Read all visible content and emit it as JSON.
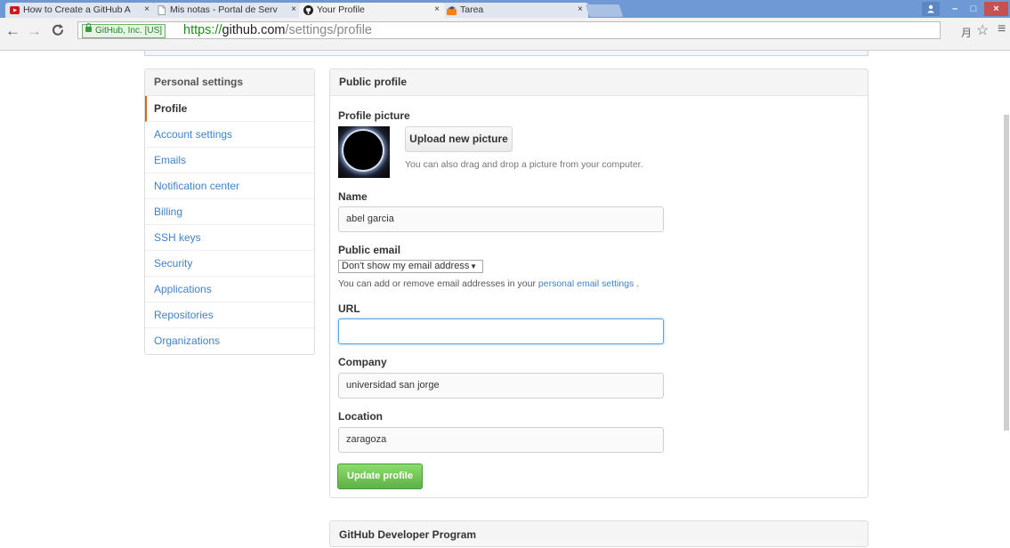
{
  "browser": {
    "tabs": [
      {
        "title": "How to Create a GitHub A",
        "icon": "youtube-icon",
        "active": false
      },
      {
        "title": "Mis notas - Portal de Serv",
        "icon": "page-icon",
        "active": false
      },
      {
        "title": "Your Profile",
        "icon": "github-icon",
        "active": true
      },
      {
        "title": "Tarea",
        "icon": "moodle-icon",
        "active": false
      }
    ],
    "tab_close": "×",
    "secure_label": "GitHub, Inc. [US]",
    "url_scheme": "https://",
    "url_host": "github.com",
    "url_path": "/settings/profile",
    "window_controls": {
      "minimize": "–",
      "maximize": "□",
      "close": "×"
    }
  },
  "sidebar": {
    "heading": "Personal settings",
    "items": [
      {
        "label": "Profile",
        "selected": true
      },
      {
        "label": "Account settings"
      },
      {
        "label": "Emails"
      },
      {
        "label": "Notification center"
      },
      {
        "label": "Billing"
      },
      {
        "label": "SSH keys"
      },
      {
        "label": "Security"
      },
      {
        "label": "Applications"
      },
      {
        "label": "Repositories"
      },
      {
        "label": "Organizations"
      }
    ]
  },
  "profile": {
    "heading": "Public profile",
    "picture_label": "Profile picture",
    "upload_button": "Upload new picture",
    "upload_hint": "You can also drag and drop a picture from your computer.",
    "name_label": "Name",
    "name_value": "abel garcia",
    "email_label": "Public email",
    "email_selected": "Don't show my email address",
    "email_hint_prefix": "You can add or remove email addresses in your",
    "email_hint_link": "personal email settings",
    "email_hint_suffix": ".",
    "url_label": "URL",
    "url_value": "",
    "company_label": "Company",
    "company_value": "universidad san jorge",
    "location_label": "Location",
    "location_value": "zaragoza",
    "update_button": "Update profile"
  },
  "developer_program": {
    "heading": "GitHub Developer Program"
  },
  "colors": {
    "link": "#4183c4",
    "selected_accent": "#d26911",
    "primary_button": "#60b044",
    "focus_border": "#51a7e8",
    "titlebar": "#6e99d4",
    "close_button": "#c75050"
  }
}
